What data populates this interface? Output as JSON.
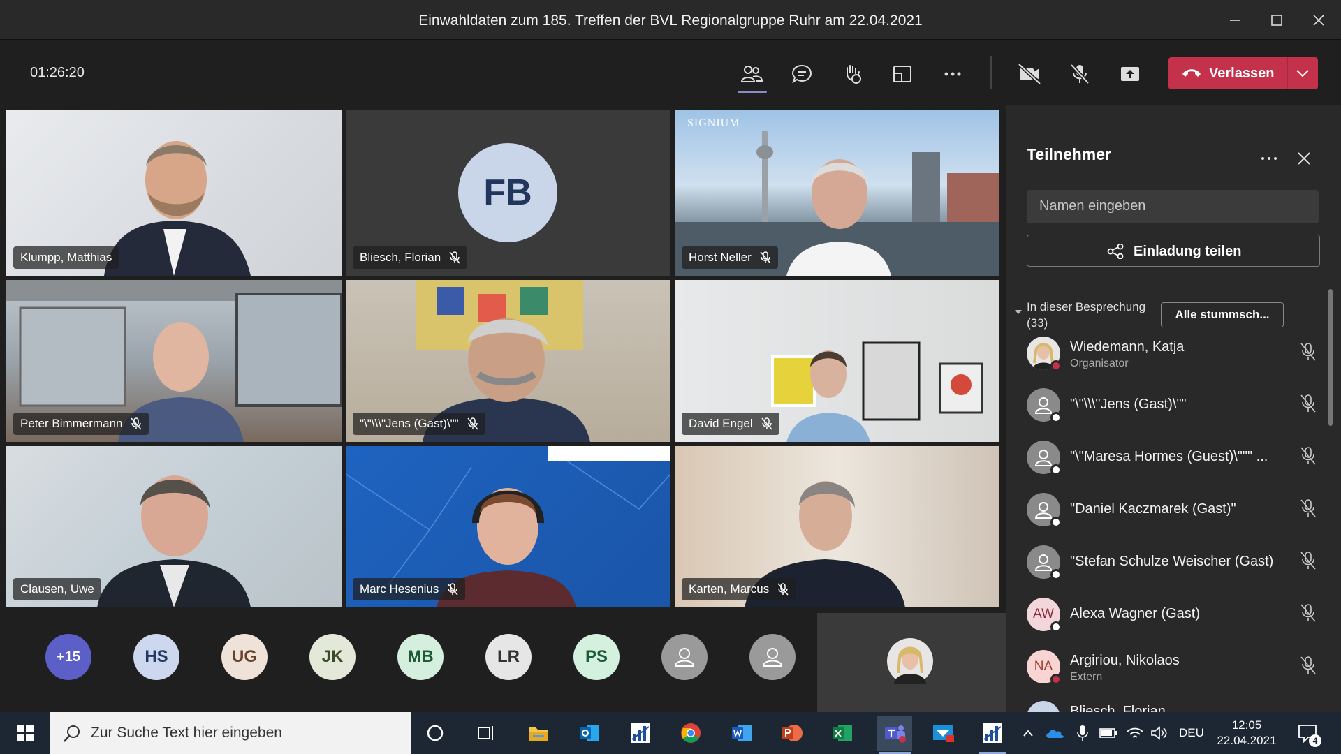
{
  "window": {
    "title": "Einwahldaten zum 185. Treffen der BVL Regionalgruppe Ruhr am 22.04.2021"
  },
  "callbar": {
    "timer": "01:26:20",
    "leave_label": "Verlassen"
  },
  "tiles": [
    {
      "name": "Klumpp, Matthias",
      "muted": false
    },
    {
      "name": "Bliesch, Florian",
      "muted": true,
      "initials": "FB"
    },
    {
      "name": "Horst Neller",
      "muted": true,
      "logo_text": "SIGNIUM"
    },
    {
      "name": "Peter Bimmermann",
      "muted": true
    },
    {
      "name": "\"\\\"\\\\\\\"Jens (Gast)\\\"\"",
      "muted": true
    },
    {
      "name": "David Engel",
      "muted": true
    },
    {
      "name": "Clausen, Uwe",
      "muted": false
    },
    {
      "name": "Marc Hesenius",
      "muted": true
    },
    {
      "name": "Karten, Marcus",
      "muted": true
    }
  ],
  "strip": [
    "+15",
    "HS",
    "UG",
    "JK",
    "MB",
    "LR",
    "PS"
  ],
  "panel": {
    "title": "Teilnehmer",
    "search_placeholder": "Namen eingeben",
    "invite_label": "Einladung teilen",
    "section_label": "In dieser Besprechung",
    "section_count": "(33)",
    "mute_all_label": "Alle stummsch...",
    "participants": [
      {
        "name": "Wiedemann, Katja",
        "sub": "Organisator",
        "avatar": ""
      },
      {
        "name": "\"\\\"\\\\\\\"Jens (Gast)\\\"\"",
        "sub": "",
        "avatar": ""
      },
      {
        "name": "\"\\\"Maresa Hormes (Guest)\\\"\"\" ...",
        "sub": "",
        "avatar": ""
      },
      {
        "name": "\"Daniel Kaczmarek (Gast)\"",
        "sub": "",
        "avatar": ""
      },
      {
        "name": "\"Stefan Schulze Weischer (Gast)",
        "sub": "",
        "avatar": ""
      },
      {
        "name": "Alexa Wagner (Gast)",
        "sub": "",
        "avatar": "AW"
      },
      {
        "name": "Argiriou, Nikolaos",
        "sub": "Extern",
        "avatar": "NA"
      },
      {
        "name": "Bliesch, Florian",
        "sub": "",
        "avatar": ""
      }
    ]
  },
  "taskbar": {
    "search_placeholder": "Zur Suche Text hier eingeben",
    "lang": "DEU",
    "time": "12:05",
    "date": "22.04.2021",
    "notif_count": "4"
  },
  "colors": {
    "leave": "#c4314b",
    "accent": "#6264a7",
    "panel": "#292929"
  }
}
